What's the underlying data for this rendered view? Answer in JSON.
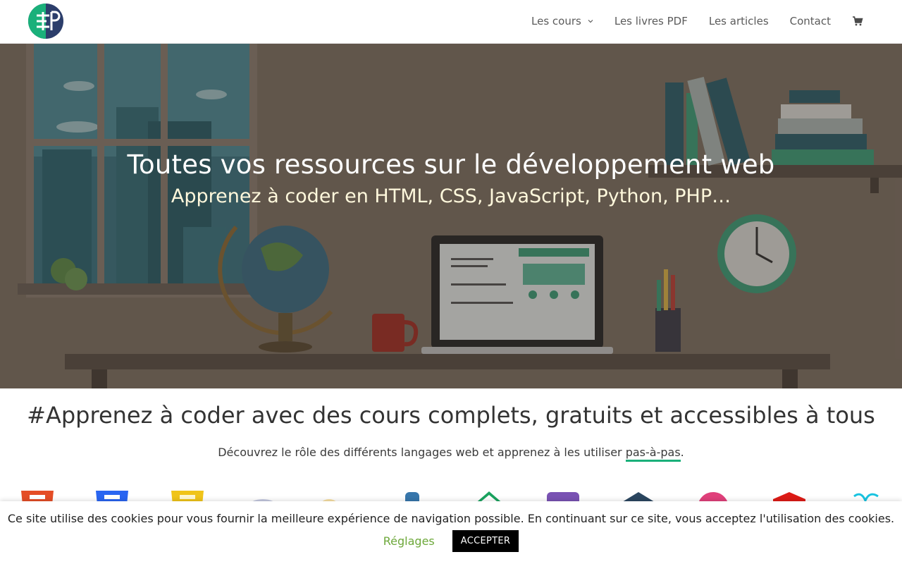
{
  "header": {
    "logo_icon": "site-logo",
    "nav": [
      {
        "label": "Les cours",
        "has_dropdown": true
      },
      {
        "label": "Les livres PDF"
      },
      {
        "label": "Les articles"
      },
      {
        "label": "Contact"
      }
    ],
    "cart_icon": "shopping-cart-icon"
  },
  "hero": {
    "title": "Toutes vos ressources sur le développement web",
    "subtitle": "Apprenez à coder en HTML, CSS, JavaScript, Python, PHP…"
  },
  "section": {
    "title": "#Apprenez à coder avec des cours complets, gratuits et accessibles à tous",
    "desc_prefix": "Découvrez le rôle des différents langages web et apprenez à les utiliser ",
    "desc_highlight": "pas-à-pas",
    "desc_suffix": "."
  },
  "languages": [
    "html5-icon",
    "css3-icon",
    "javascript-icon",
    "php-icon",
    "sql-icon",
    "python-icon",
    "vuejs-icon",
    "bootstrap-icon",
    "sass-icon",
    "redux-icon",
    "angular-icon",
    "ux-icon"
  ],
  "cookie": {
    "text": "Ce site utilise des cookies pour vous fournir la meilleure expérience de navigation possible. En continuant sur ce site, vous acceptez l'utilisation des cookies.",
    "settings_label": "Réglages",
    "accept_label": "ACCEPTER"
  },
  "colors": {
    "accent": "#1ab07a",
    "settings_link": "#6da83a",
    "accept_bg": "#000000"
  }
}
